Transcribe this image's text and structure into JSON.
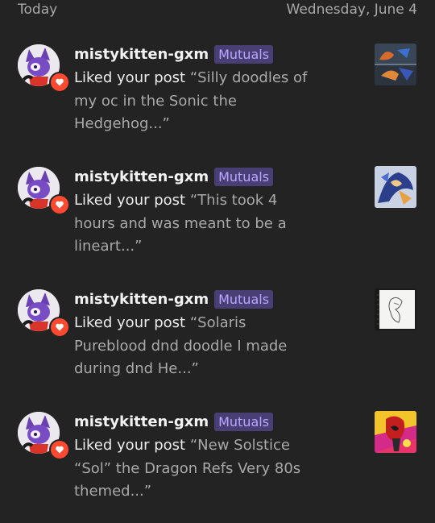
{
  "header": {
    "left": "Today",
    "right": "Wednesday, June 4"
  },
  "colors": {
    "background": "#232323",
    "mutuals_badge_bg": "#4a3f74",
    "mutuals_badge_text": "#b9a6ff",
    "heart": "#ff4930"
  },
  "notifications": [
    {
      "username": "mistykitten-gxm",
      "badge": "Mutuals",
      "action": "Liked your post",
      "quote_l1": "“Silly doodles of",
      "quote_l2": "my oc in the Sonic the",
      "quote_l3": "Hedgehog...”",
      "thumbnail_icon": "post-thumbnail"
    },
    {
      "username": "mistykitten-gxm",
      "badge": "Mutuals",
      "action": "Liked your post",
      "quote_l1": "“This took 4",
      "quote_l2": "hours and was meant to be a",
      "quote_l3": "lineart...”",
      "thumbnail_icon": "post-thumbnail"
    },
    {
      "username": "mistykitten-gxm",
      "badge": "Mutuals",
      "action": "Liked your post",
      "quote_l1": "“Solaris",
      "quote_l2": "Pureblood dnd doodle I made",
      "quote_l3": "during dnd He...”",
      "thumbnail_icon": "post-thumbnail"
    },
    {
      "username": "mistykitten-gxm",
      "badge": "Mutuals",
      "action": "Liked your post",
      "quote_l1": "“New Solstice",
      "quote_l2": "“Sol” the Dragon Refs Very 80s",
      "quote_l3": "themed...”",
      "thumbnail_icon": "post-thumbnail"
    }
  ]
}
